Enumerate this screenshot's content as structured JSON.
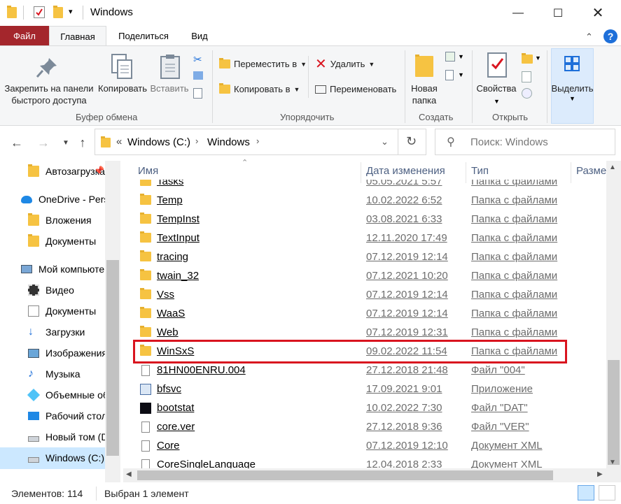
{
  "window": {
    "title": "Windows"
  },
  "ribbon_tabs": [
    "Файл",
    "Главная",
    "Поделиться",
    "Вид"
  ],
  "ribbon": {
    "clipboard": {
      "pin_label": "Закрепить на панели\nбыстрого доступа",
      "copy_label": "Копировать",
      "paste_label": "Вставить",
      "group": "Буфер обмена"
    },
    "organize": {
      "move_to": "Переместить в",
      "copy_to": "Копировать в",
      "delete": "Удалить",
      "rename": "Переименовать",
      "group": "Упорядочить"
    },
    "create": {
      "new_folder": "Новая\nпапка",
      "group": "Создать"
    },
    "open": {
      "properties": "Свойства",
      "group": "Открыть"
    },
    "select": {
      "label": "Выделить"
    }
  },
  "address": {
    "breadcrumb_prefix": "«",
    "path": [
      "Windows (C:)",
      "Windows"
    ],
    "search_placeholder": "Поиск: Windows"
  },
  "nav_pane": {
    "items": [
      {
        "label": "Автозагрузка",
        "icon": "folder-icon"
      },
      {
        "label": "OneDrive - Personal",
        "icon": "onedrive-icon"
      },
      {
        "label": "Вложения",
        "icon": "folder-icon"
      },
      {
        "label": "Документы",
        "icon": "folder-icon"
      },
      {
        "label": "Мой компьютер",
        "icon": "computer-icon"
      },
      {
        "label": "Видео",
        "icon": "video-icon"
      },
      {
        "label": "Документы",
        "icon": "documents-icon"
      },
      {
        "label": "Загрузки",
        "icon": "download-icon"
      },
      {
        "label": "Изображения",
        "icon": "pictures-icon"
      },
      {
        "label": "Музыка",
        "icon": "music-icon"
      },
      {
        "label": "Объемные объекты",
        "icon": "3d-objects-icon"
      },
      {
        "label": "Рабочий стол",
        "icon": "desktop-icon"
      },
      {
        "label": "Новый том (D:)",
        "icon": "drive-icon"
      },
      {
        "label": "Windows (C:)",
        "icon": "windows-drive-icon"
      }
    ]
  },
  "columns": {
    "name": "Имя",
    "date": "Дата изменения",
    "type": "Тип",
    "size": "Разме"
  },
  "files": [
    {
      "name": "Tasks",
      "date": "05.05.2021 5:57",
      "type": "Папка с файлами",
      "kind": "folder"
    },
    {
      "name": "Temp",
      "date": "10.02.2022 6:52",
      "type": "Папка с файлами",
      "kind": "folder"
    },
    {
      "name": "TempInst",
      "date": "03.08.2021 6:33",
      "type": "Папка с файлами",
      "kind": "folder"
    },
    {
      "name": "TextInput",
      "date": "12.11.2020 17:49",
      "type": "Папка с файлами",
      "kind": "folder"
    },
    {
      "name": "tracing",
      "date": "07.12.2019 12:14",
      "type": "Папка с файлами",
      "kind": "folder"
    },
    {
      "name": "twain_32",
      "date": "07.12.2021 10:20",
      "type": "Папка с файлами",
      "kind": "folder"
    },
    {
      "name": "Vss",
      "date": "07.12.2019 12:14",
      "type": "Папка с файлами",
      "kind": "folder"
    },
    {
      "name": "WaaS",
      "date": "07.12.2019 12:14",
      "type": "Папка с файлами",
      "kind": "folder"
    },
    {
      "name": "Web",
      "date": "07.12.2019 12:31",
      "type": "Папка с файлами",
      "kind": "folder"
    },
    {
      "name": "WinSxS",
      "date": "09.02.2022 11:54",
      "type": "Папка с файлами",
      "kind": "folder"
    },
    {
      "name": "81HN00ENRU.004",
      "date": "27.12.2018 21:48",
      "type": "Файл \"004\"",
      "kind": "file"
    },
    {
      "name": "bfsvc",
      "date": "17.09.2021 9:01",
      "type": "Приложение",
      "kind": "app"
    },
    {
      "name": "bootstat",
      "date": "10.02.2022 7:30",
      "type": "Файл \"DAT\"",
      "kind": "dat"
    },
    {
      "name": "core.ver",
      "date": "27.12.2018 9:36",
      "type": "Файл \"VER\"",
      "kind": "file"
    },
    {
      "name": "Core",
      "date": "07.12.2019 12:10",
      "type": "Документ XML",
      "kind": "file"
    },
    {
      "name": "CoreSingleLanguage",
      "date": "12.04.2018 2:33",
      "type": "Документ XML",
      "kind": "file"
    }
  ],
  "status": {
    "count": "Элементов: 114",
    "selected": "Выбран 1 элемент"
  },
  "colors": {
    "file_tab": "#a4262c",
    "highlight": "#d9141f",
    "folder": "#f6c342",
    "selection": "#cce8ff"
  }
}
